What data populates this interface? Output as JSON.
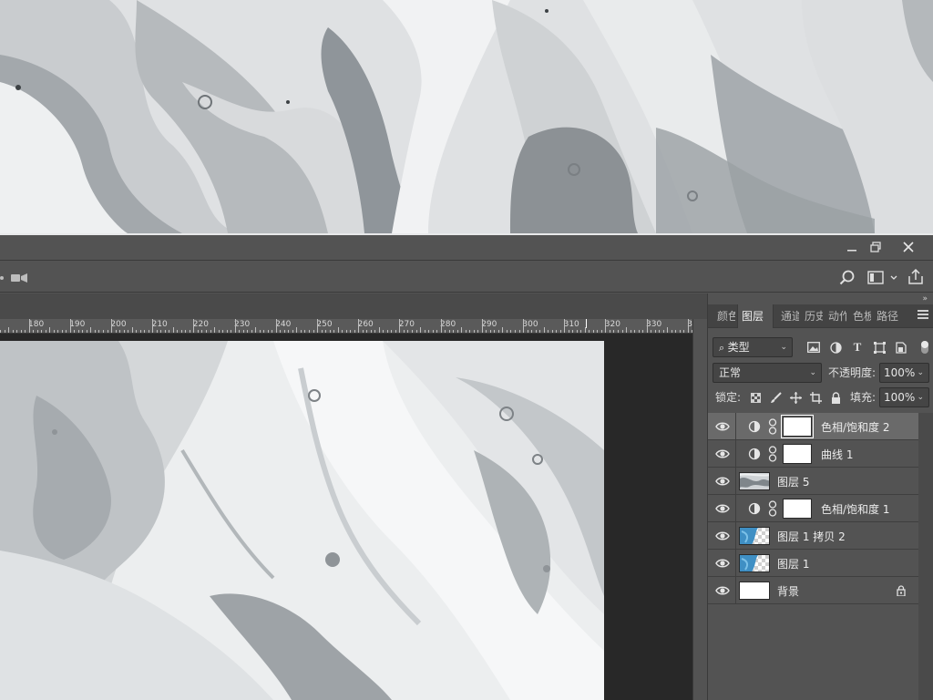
{
  "toolbar": {
    "search_icon": "search-icon",
    "workspace_icon": "workspace-layout-icon",
    "share_icon": "share-icon",
    "video_icon": "video-timeline-icon"
  },
  "ruler": {
    "labels": [
      "180",
      "190",
      "200",
      "210",
      "220",
      "230",
      "240",
      "250",
      "260",
      "270",
      "280",
      "290",
      "300",
      "310",
      "320",
      "330",
      "3"
    ]
  },
  "panel": {
    "tabs": [
      "颜色",
      "图层",
      "通道",
      "历史",
      "动作",
      "色板",
      "路径"
    ],
    "active_tab": "图层",
    "filter_kind": "类型",
    "blend_mode": "正常",
    "opacity_label": "不透明度:",
    "opacity_value": "100%",
    "lock_label": "锁定:",
    "fill_label": "填充:",
    "fill_value": "100%"
  },
  "layers": [
    {
      "name": "色相/饱和度 2",
      "type": "adjustment",
      "selected": true
    },
    {
      "name": "曲线 1",
      "type": "adjustment",
      "selected": false
    },
    {
      "name": "图层 5",
      "type": "marble",
      "selected": false
    },
    {
      "name": "色相/饱和度 1",
      "type": "adjustment",
      "selected": false
    },
    {
      "name": "图层 1 拷贝 2",
      "type": "blue",
      "selected": false
    },
    {
      "name": "图层 1",
      "type": "blue",
      "selected": false
    },
    {
      "name": "背景",
      "type": "background",
      "selected": false,
      "locked": true
    }
  ],
  "colors": {
    "panel_bg": "#535353",
    "selected_row": "#6a6a6a",
    "workspace_bg": "#282828",
    "marble_light": "#f2f3f4",
    "marble_mid": "#b9bdc0",
    "marble_dark": "#8e9397"
  }
}
